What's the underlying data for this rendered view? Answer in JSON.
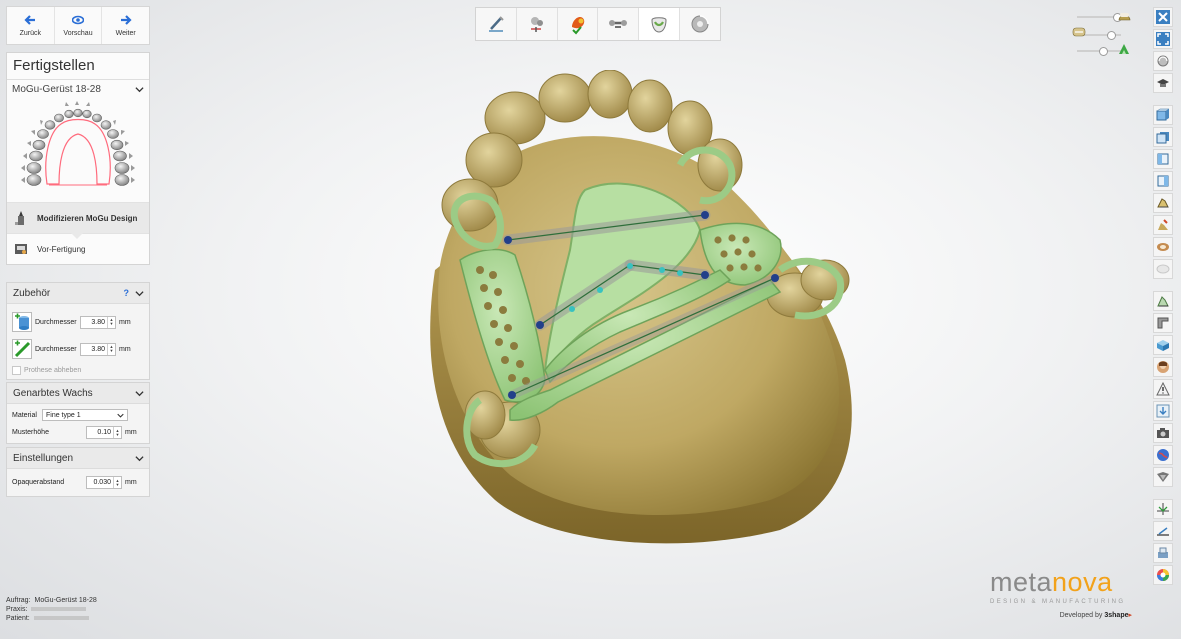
{
  "nav": {
    "back_label": "Zurück",
    "preview_label": "Vorschau",
    "next_label": "Weiter"
  },
  "panel": {
    "title": "Fertigstellen",
    "case_name": "MoGu-Gerüst 18-28",
    "steps": [
      {
        "label": "Modifizieren MoGu Design",
        "active": true
      },
      {
        "label": "Vor-Fertigung",
        "active": false
      }
    ]
  },
  "accessories": {
    "title": "Zubehör",
    "help": "?",
    "tools": [
      {
        "label": "Durchmesser",
        "value": "3.80",
        "unit": "mm"
      },
      {
        "label": "Durchmesser",
        "value": "3.80",
        "unit": "mm"
      }
    ],
    "checkbox_label": "Prothese abheben"
  },
  "wax": {
    "title": "Genarbtes Wachs",
    "material_label": "Material",
    "material_value": "Fine type 1",
    "height_label": "Musterhöhe",
    "height_value": "0.10",
    "unit": "mm"
  },
  "settings": {
    "title": "Einstellungen",
    "opaquer_label": "Opaquerabstand",
    "opaquer_value": "0.030",
    "unit": "mm"
  },
  "toolbar": {
    "icons": [
      "scan-edit-icon",
      "wax-tools-icon",
      "color-apply-icon",
      "connector-icon",
      "framework-icon",
      "export-disc-icon"
    ],
    "active_index": 4
  },
  "sliders": [
    {
      "name": "model-transparency-slider",
      "level": 0.75
    },
    {
      "name": "wax-transparency-slider",
      "level": 0.7
    },
    {
      "name": "framework-transparency-slider",
      "level": 0.55
    }
  ],
  "right_toolbar": [
    "close-icon",
    "fullscreen-icon",
    "rotate-icon",
    "hat-icon",
    "view-front-icon",
    "view-back-icon",
    "view-left-icon",
    "view-right-icon",
    "view-top-icon",
    "view-bottom-icon",
    "view-occlusal-icon",
    "tooth-outline-icon",
    "measure-icon",
    "section-icon",
    "box-icon",
    "avatar-icon",
    "warning-icon",
    "down-arrow-icon",
    "snapshot-icon",
    "globe-icon",
    "shield-icon",
    "axis-icon",
    "profile-icon",
    "print-icon",
    "color-wheel-icon"
  ],
  "colors": {
    "framework": "#a3cf8f",
    "model": "#c2ae6f",
    "accent": "#2a6ed6",
    "brand_orange": "#f2a21b"
  },
  "footer": {
    "order_label": "Auftrag:",
    "order_value": "MoGu-Gerüst 18-28",
    "practice_label": "Praxis:",
    "patient_label": "Patient:"
  },
  "brand": {
    "logo_a": "meta",
    "logo_b": "nova",
    "tagline": "DESIGN & MANUFACTURING",
    "developed_by": "Developed by",
    "vendor": "3shape"
  }
}
